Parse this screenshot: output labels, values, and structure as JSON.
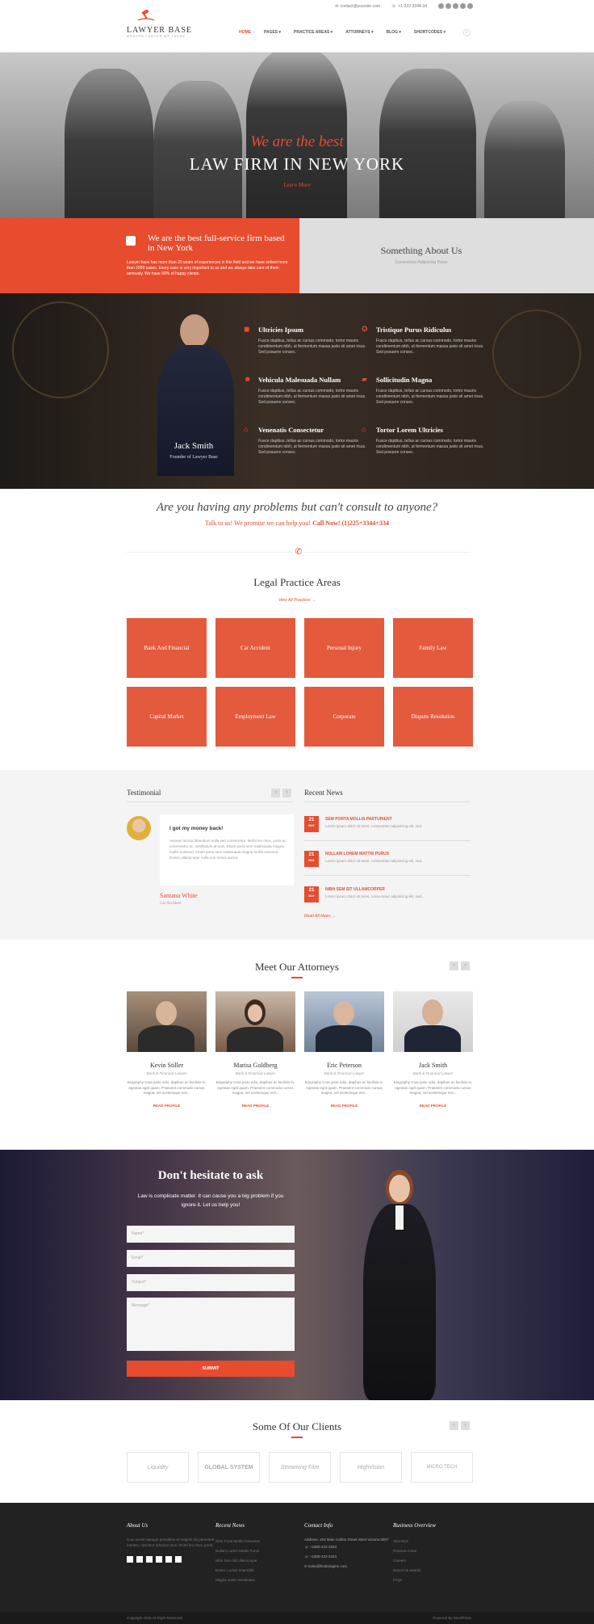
{
  "header": {
    "email": "contact@yoursite.com",
    "phone": "+1-222-3344-34",
    "logo_title": "LAWYER BASE",
    "logo_tagline": "MODERN LAWYER WP THEME",
    "nav": [
      "HOME",
      "PAGES",
      "PRACTICE AREAS",
      "ATTORNEYS",
      "BLOG",
      "SHORTCODES"
    ],
    "nav_active": "HOME",
    "accent": "#e74c2f"
  },
  "hero": {
    "subtitle": "We are the best",
    "title": "LAW FIRM IN NEW YORK",
    "link": "Learn More"
  },
  "intro": {
    "title": "We are the best full-service firm based in New York",
    "text": "Lawyer base has more than 20 years of experiences in this field and we have solved more than 2000 cases. Every case is very important to us and we always take care of them seriously. We have 99% of happy clients.",
    "right_title": "Something About Us",
    "right_sub": "Consectetur Adipiscing Purus"
  },
  "profile": {
    "name": "Jack Smith",
    "role": "Founder of Lawyer Base"
  },
  "features": [
    {
      "title": "Ultricies Ipsum",
      "text": "Fusce dapibus, tellus ac cursus commodo, tortor mauris condimentum nibh, ut fermentum massa justo sit amet risus. Sed posuere consec.",
      "icon": "car-icon"
    },
    {
      "title": "Tristique Purus Ridiculus",
      "text": "Fusce dapibus, tellus ac cursus commodo, tortor mauris condimentum nibh, ut fermentum massa justo sit amet risus. Sed posuere consec.",
      "icon": "lifebuoy-icon"
    },
    {
      "title": "Vehicula Malesuada Nullam",
      "text": "Fusce dapibus, tellus ac cursus commodo, tortor mauris condimentum nibh, ut fermentum massa justo sit amet risus. Sed posuere consec.",
      "icon": "people-icon"
    },
    {
      "title": "Sollicitudin Magna",
      "text": "Fusce dapibus, tellus ac cursus commodo, tortor mauris condimentum nibh, ut fermentum massa justo sit amet risus. Sed posuere consec.",
      "icon": "truck-icon"
    },
    {
      "title": "Venenatis Consectetur",
      "text": "Fusce dapibus, tellus ac cursus commodo, tortor mauris condimentum nibh, ut fermentum massa justo sit amet risus. Sed posuere consec.",
      "icon": "bank-icon"
    },
    {
      "title": "Tortor Lorem Ultricies",
      "text": "Fusce dapibus, tellus ac cursus commodo, tortor mauris condimentum nibh, ut fermentum massa justo sit amet risus. Sed posuere consec.",
      "icon": "home-icon"
    }
  ],
  "problems": {
    "title": "Are you having any problems but can't consult to anyone?",
    "text": "Talk to us! We promise we can help you!",
    "call": "Call Now! (1)225+3344+334"
  },
  "practice": {
    "title": "Legal Practice Areas",
    "link": "View All Practices",
    "items": [
      "Bank And Financial",
      "Car Accident",
      "Personal Injury",
      "Family Law",
      "Capital Market",
      "Employment Law",
      "Corporate",
      "Dispute Resolution"
    ]
  },
  "testimonial": {
    "title": "Testimonial",
    "quote_title": "I got my money back!",
    "quote": "Aenean lacinia bibendum nulla sed consectetur. Morbi leo risus, porta ac consectetur ac, vestibulum at eros. Etiam porta sem malesuada magna mollis euismod. Etiam porta sem malesuada magna mollis euismod. Donec ullamcorper nulla non metus auctor.",
    "name": "Santana White",
    "case": "Car Accident"
  },
  "news": {
    "title": "Recent News",
    "items": [
      {
        "day": "21",
        "month": "MAY",
        "title": "SEM PORTA MOLLIS PARTURIENT",
        "text": "Lorem ipsum dolor sit amet, consectetur adipisicing elit, sed..."
      },
      {
        "day": "21",
        "month": "MAY",
        "title": "NULLAM LOREM MATTIS PURUS",
        "text": "Lorem ipsum dolor sit amet, consectetur adipisicing elit, sed..."
      },
      {
        "day": "21",
        "month": "MAY",
        "title": "NIBH SEM SIT ULLAMCORPER",
        "text": "Lorem ipsum dolor sit amet, consectetur adipisicing elit, sed..."
      }
    ],
    "link": "Read All News"
  },
  "attorneys": {
    "title": "Meet Our Attorneys",
    "items": [
      {
        "name": "Kevin Stiller",
        "role": "Bank & Financial Lawyer"
      },
      {
        "name": "Marisa Goldberg",
        "role": "Bank & Financial Lawyer"
      },
      {
        "name": "Eric Peterson",
        "role": "Bank & Financial Lawyer"
      },
      {
        "name": "Jack Smith",
        "role": "Bank & Financial Lawyer"
      }
    ],
    "bio": "Biography Cras justo odio, dapibus ac facilisis in, egestas eget quam. Praesent commodo cursus magna, vel scelerisque nisl...",
    "more": "READ PROFILE"
  },
  "contact": {
    "title": "Don't hesitate to ask",
    "text": "Law is complicate matter. It can cause you a big problem if you ignore it. Let us help you!",
    "name_placeholder": "Name*",
    "email_placeholder": "Email*",
    "subject_placeholder": "Subject*",
    "message_placeholder": "Message*",
    "submit": "SUBMIT"
  },
  "clients": {
    "title": "Some Of Our Clients",
    "items": [
      "Liquidity",
      "GLOBAL SYSTEM",
      "Streaming Film",
      "HighVision",
      "MICRO TECH"
    ]
  },
  "footer": {
    "about_title": "About Us",
    "about_text": "Cum sociis natoque penatibus et magnis dis parturient montes, nascetur ridiculus mus. Morbi leo risus, porta.",
    "news_title": "Recent News",
    "news_items": [
      "Sem Porta Mollis Parturient",
      "Nullam Lorem Mattis Purus",
      "Nibh Sem Sit Ullamcorper",
      "Donec Luctus Imperdiet",
      "Magna Justo Vestibulum"
    ],
    "contact_title": "Contact Info",
    "address": "Address: 194 Main Collins Street West Victoria 8007",
    "phone1": "+1800-222-3333",
    "phone2": "+1800-222-3443",
    "mail": "sales@findimagine.com",
    "biz_title": "Business Overview",
    "biz_items": [
      "Attorneys",
      "Practice Areas",
      "Careers",
      "Honors & Awards",
      "FAQs"
    ],
    "copyright": "Copyright 2015 All Right Reserved",
    "powered": "Powered By WordPress"
  }
}
